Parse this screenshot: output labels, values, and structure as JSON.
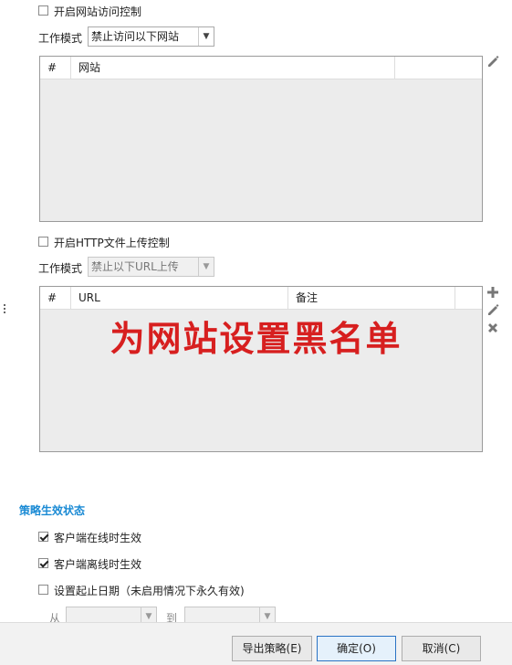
{
  "web_access": {
    "enable_label": "开启网站访问控制",
    "enabled": false,
    "mode_label": "工作模式",
    "mode_value": "禁止访问以下网站",
    "columns": [
      "#",
      "网站"
    ]
  },
  "http_upload": {
    "enable_label": "开启HTTP文件上传控制",
    "enabled": false,
    "mode_label": "工作模式",
    "mode_value": "禁止以下URL上传",
    "columns": [
      "#",
      "URL",
      "备注"
    ]
  },
  "overlay_caption": "为网站设置黑名单",
  "policy_status": {
    "title": "策略生效状态",
    "online_label": "客户端在线时生效",
    "online_checked": true,
    "offline_label": "客户端离线时生效",
    "offline_checked": true,
    "date_label": "设置起止日期（未启用情况下永久有效)",
    "date_checked": false,
    "from_label": "从",
    "to_label": "到"
  },
  "footer": {
    "export_label": "导出策略(E)",
    "ok_label": "确定(O)",
    "cancel_label": "取消(C)"
  },
  "colors": {
    "accent": "#1a8ad4",
    "overlay": "#d71f1f"
  }
}
